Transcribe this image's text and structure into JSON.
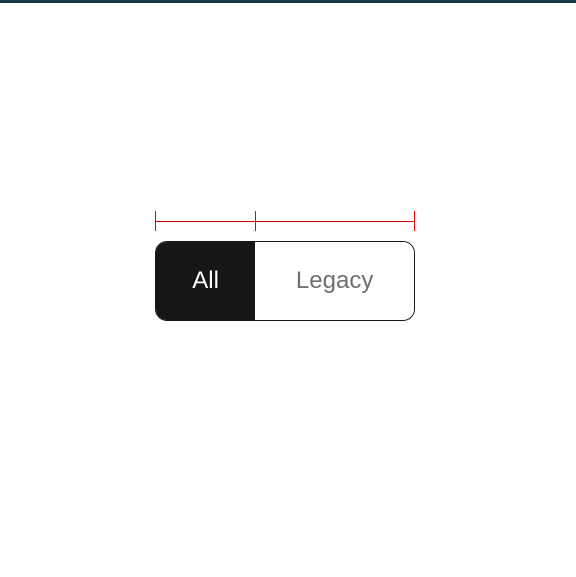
{
  "segmented": {
    "options": [
      {
        "label": "All",
        "active": true
      },
      {
        "label": "Legacy",
        "active": false
      }
    ]
  },
  "colors": {
    "ruler": "#e60000",
    "active_bg": "#161616",
    "active_fg": "#ffffff",
    "inactive_fg": "#6f6f6f"
  }
}
